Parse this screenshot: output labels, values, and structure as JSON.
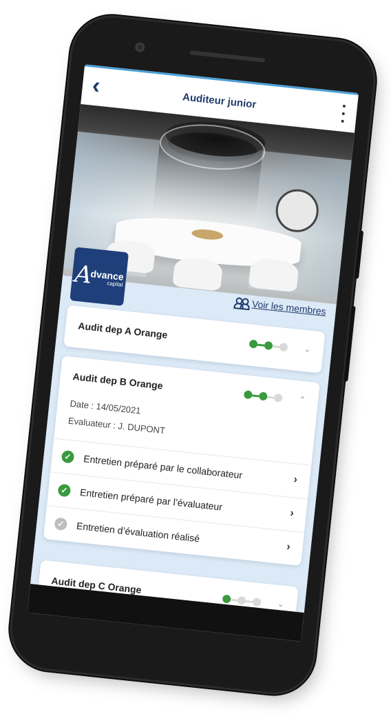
{
  "header": {
    "title": "Auditeur junior",
    "back_glyph": "‹",
    "menu_icon": "more-vertical-icon"
  },
  "hero": {
    "logo": {
      "letter": "A",
      "word": "dvance",
      "sub": "capital",
      "color": "#1f3f7a"
    }
  },
  "members_link": {
    "label": "Voir les membres",
    "icon": "people-icon"
  },
  "audits": [
    {
      "title": "Audit dep A Orange",
      "progress_steps_done": 2,
      "progress_steps_total": 3,
      "expanded": false,
      "chevron": "⌄"
    },
    {
      "title": "Audit dep B Orange",
      "progress_steps_done": 2,
      "progress_steps_total": 3,
      "expanded": true,
      "chevron": "⌃",
      "date": "Date : 14/05/2021",
      "evaluator": "Evaluateur : J. DUPONT",
      "tasks": [
        {
          "label": "Entretien préparé par le collaborateur",
          "done": true,
          "arrow": "›"
        },
        {
          "label": "Entretien préparé par l’évaluateur",
          "done": true,
          "arrow": "›"
        },
        {
          "label": "Entretien d’évaluation réalisé",
          "done": false,
          "arrow": "›"
        }
      ]
    },
    {
      "title": "Audit dep C Orange",
      "progress_steps_done": 1,
      "progress_steps_total": 3,
      "expanded": false,
      "chevron": "⌄"
    }
  ],
  "colors": {
    "accent": "#1f3a6b",
    "done": "#3a9a3e",
    "pending": "#d9d9d9",
    "screen_bg": "#dce9f6"
  }
}
